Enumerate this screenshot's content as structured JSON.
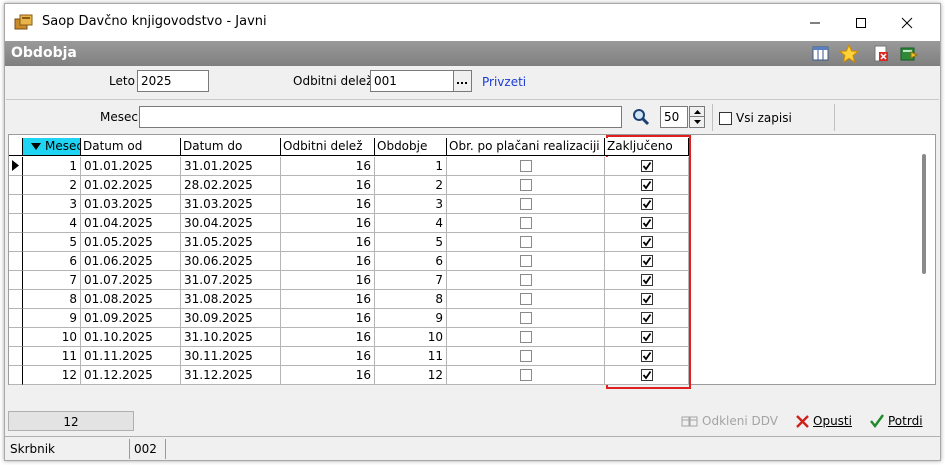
{
  "window": {
    "title": "Saop Davčno knjigovodstvo - Javni"
  },
  "section": {
    "title": "Obdobja"
  },
  "filters": {
    "leto_label": "Leto",
    "leto_value": "2025",
    "odbitni_label": "Odbitni delež",
    "odbitni_value": "001",
    "ellipsis": "...",
    "privzeti_link": "Privzeti",
    "mesec_label": "Mesec",
    "mesec_value": "",
    "page_size": "50",
    "vsi_zapisi_label": "Vsi zapisi"
  },
  "grid": {
    "columns": [
      "Mesec",
      "Datum od",
      "Datum do",
      "Odbitni delež",
      "Obdobje",
      "Obr. po plačani realizaciji",
      "Zaključeno"
    ],
    "rows": [
      {
        "mesec": "1",
        "od": "01.01.2025",
        "do": "31.01.2025",
        "delez": "16",
        "obdobje": "1",
        "obr": false,
        "zakljuceno": true
      },
      {
        "mesec": "2",
        "od": "01.02.2025",
        "do": "28.02.2025",
        "delez": "16",
        "obdobje": "2",
        "obr": false,
        "zakljuceno": true
      },
      {
        "mesec": "3",
        "od": "01.03.2025",
        "do": "31.03.2025",
        "delez": "16",
        "obdobje": "3",
        "obr": false,
        "zakljuceno": true
      },
      {
        "mesec": "4",
        "od": "01.04.2025",
        "do": "30.04.2025",
        "delez": "16",
        "obdobje": "4",
        "obr": false,
        "zakljuceno": true
      },
      {
        "mesec": "5",
        "od": "01.05.2025",
        "do": "31.05.2025",
        "delez": "16",
        "obdobje": "5",
        "obr": false,
        "zakljuceno": true
      },
      {
        "mesec": "6",
        "od": "01.06.2025",
        "do": "30.06.2025",
        "delez": "16",
        "obdobje": "6",
        "obr": false,
        "zakljuceno": true
      },
      {
        "mesec": "7",
        "od": "01.07.2025",
        "do": "31.07.2025",
        "delez": "16",
        "obdobje": "7",
        "obr": false,
        "zakljuceno": true
      },
      {
        "mesec": "8",
        "od": "01.08.2025",
        "do": "31.08.2025",
        "delez": "16",
        "obdobje": "8",
        "obr": false,
        "zakljuceno": true
      },
      {
        "mesec": "9",
        "od": "01.09.2025",
        "do": "30.09.2025",
        "delez": "16",
        "obdobje": "9",
        "obr": false,
        "zakljuceno": true
      },
      {
        "mesec": "10",
        "od": "01.10.2025",
        "do": "31.10.2025",
        "delez": "16",
        "obdobje": "10",
        "obr": false,
        "zakljuceno": true
      },
      {
        "mesec": "11",
        "od": "01.11.2025",
        "do": "30.11.2025",
        "delez": "16",
        "obdobje": "11",
        "obr": false,
        "zakljuceno": true
      },
      {
        "mesec": "12",
        "od": "01.12.2025",
        "do": "31.12.2025",
        "delez": "16",
        "obdobje": "12",
        "obr": false,
        "zakljuceno": true
      }
    ]
  },
  "footer": {
    "record_count": "12",
    "odkleni_label": "Odkleni DDV",
    "opusti_label": "Opusti",
    "potrdi_label": "Potrdi"
  },
  "statusbar": {
    "user_label": "Skrbnik",
    "code": "002"
  },
  "colors": {
    "sorted_header": "#1fd3f2",
    "highlight": "#e0201f",
    "link": "#1a3bd6",
    "section_bar": "#8a8a8a"
  }
}
